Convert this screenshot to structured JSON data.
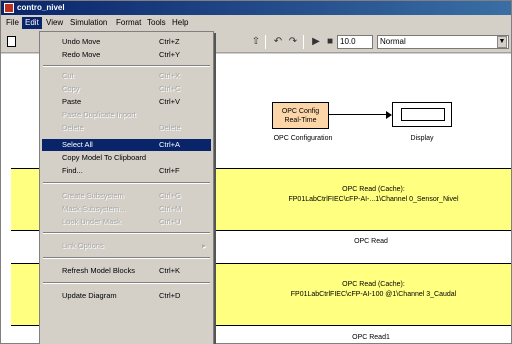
{
  "window": {
    "title": "contro_nivel"
  },
  "menubar": [
    "File",
    "Edit",
    "View",
    "Simulation",
    "Format",
    "Tools",
    "Help"
  ],
  "toolbar": {
    "stop_time": "10.0",
    "sim_mode": "Normal"
  },
  "edit_menu": [
    {
      "label": "Undo Move",
      "shortcut": "Ctrl+Z",
      "disabled": false
    },
    {
      "label": "Redo Move",
      "shortcut": "Ctrl+Y",
      "disabled": false
    },
    {
      "label": "Cut",
      "shortcut": "Ctrl+X",
      "disabled": true
    },
    {
      "label": "Copy",
      "shortcut": "Ctrl+C",
      "disabled": true
    },
    {
      "label": "Paste",
      "shortcut": "Ctrl+V",
      "disabled": false
    },
    {
      "label": "Paste Duplicate Inport",
      "shortcut": "",
      "disabled": true
    },
    {
      "label": "Delete",
      "shortcut": "Delete",
      "disabled": true
    },
    {
      "label": "Select All",
      "shortcut": "Ctrl+A",
      "disabled": false,
      "highlighted": true
    },
    {
      "label": "Copy Model To Clipboard",
      "shortcut": "",
      "disabled": false
    },
    {
      "label": "Find...",
      "shortcut": "Ctrl+F",
      "disabled": false
    },
    {
      "label": "Create Subsystem",
      "shortcut": "Ctrl+G",
      "disabled": true
    },
    {
      "label": "Mask Subsystem...",
      "shortcut": "Ctrl+M",
      "disabled": true
    },
    {
      "label": "Look Under Mask",
      "shortcut": "Ctrl+U",
      "disabled": true
    },
    {
      "label": "Link Options",
      "shortcut": "",
      "disabled": true,
      "submenu": true
    },
    {
      "label": "Refresh Model Blocks",
      "shortcut": "Ctrl+K",
      "disabled": false
    },
    {
      "label": "Update Diagram",
      "shortcut": "Ctrl+D",
      "disabled": false
    }
  ],
  "blocks": {
    "opc_config": {
      "text_line1": "OPC Config",
      "text_line2": "Real-Time",
      "caption": "OPC Configuration"
    },
    "display": {
      "caption": "Display"
    },
    "opc_read_1": {
      "line1": "OPC Read (Cache):",
      "line2": "FP01LabCtrlFIEC\\cFP-AI-...1\\Channel 0_Sensor_Nivel",
      "caption": "OPC Read"
    },
    "opc_read_2": {
      "line1": "OPC Read (Cache):",
      "line2": "FP01LabCtrlFIEC\\cFP-AI-100 @1\\Channel 3_Caudal",
      "caption": "OPC Read1"
    }
  },
  "colors": {
    "menu_highlight": "#0a246a",
    "opc_config_fill": "#fcd6a8",
    "opc_read_fill": "#ffff80"
  }
}
